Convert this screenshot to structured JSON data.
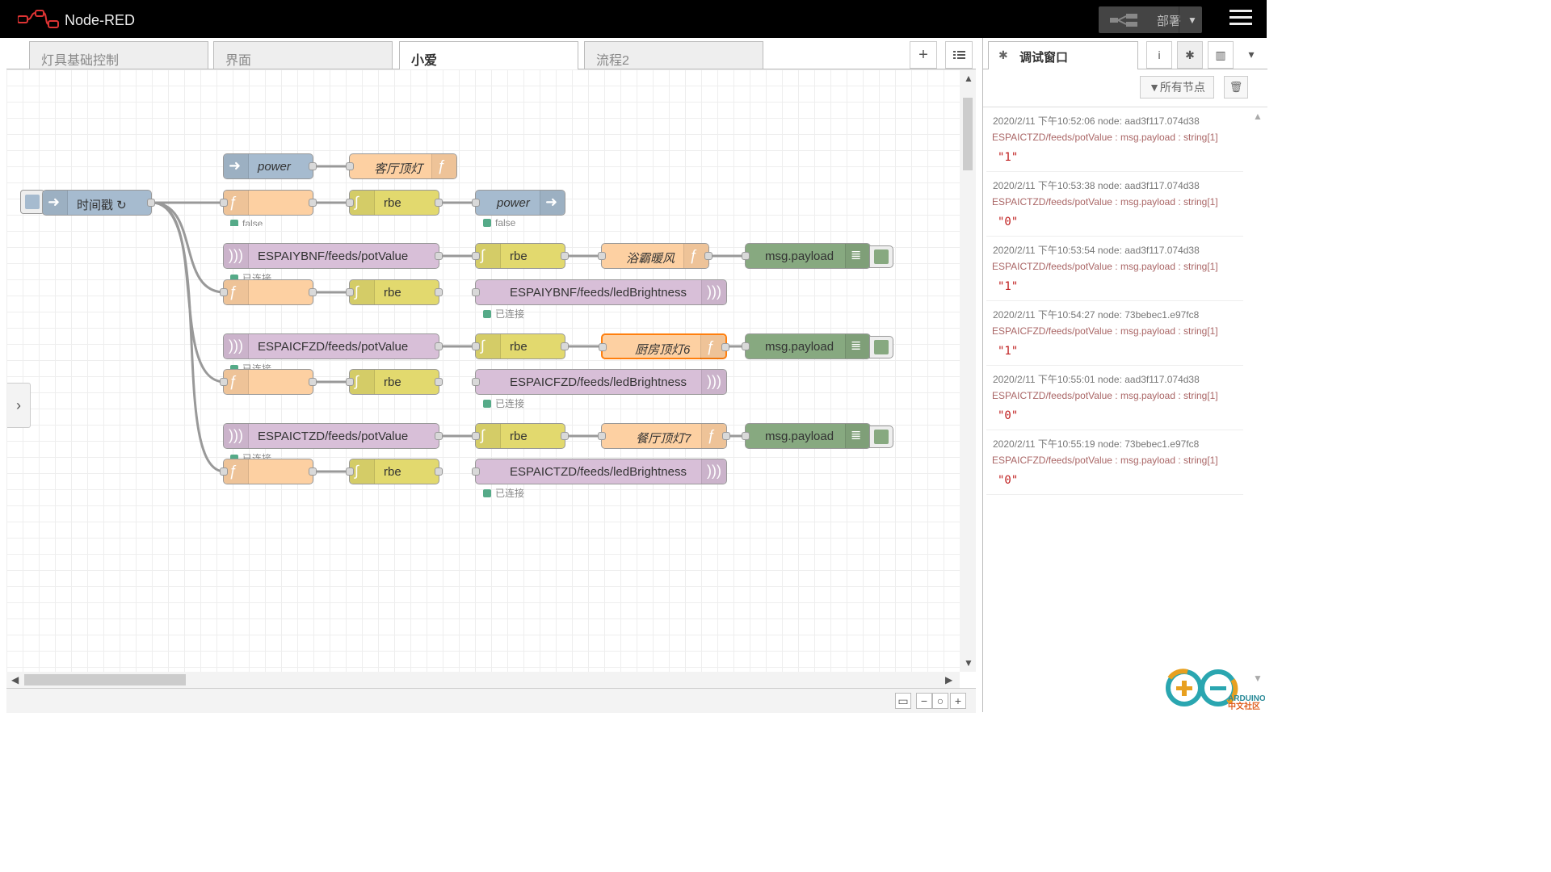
{
  "app": {
    "title": "Node-RED"
  },
  "header": {
    "deploy_label": "部署"
  },
  "tabs": [
    {
      "label": "灯具基础控制",
      "active": false
    },
    {
      "label": "界面",
      "active": false
    },
    {
      "label": "小爱",
      "active": true
    },
    {
      "label": "流程2",
      "active": false
    }
  ],
  "flow": {
    "inject_timestamp": {
      "label": "时间戳 ↻"
    },
    "link_in_power": {
      "label": "power",
      "status": "false"
    },
    "func_living_room": {
      "label": "客厅顶灯"
    },
    "func_1": {
      "label": "",
      "status": "false"
    },
    "rbe_1": {
      "label": "rbe"
    },
    "link_out_power": {
      "label": "power",
      "status": "false"
    },
    "mqtt_in_ybnf": {
      "label": "ESPAIYBNF/feeds/potValue",
      "status": "已连接"
    },
    "rbe_2": {
      "label": "rbe"
    },
    "func_bath_heater": {
      "label": "浴霸暖风"
    },
    "debug_1": {
      "label": "msg.payload"
    },
    "func_2": {
      "label": ""
    },
    "rbe_3": {
      "label": "rbe"
    },
    "mqtt_out_ybnf": {
      "label": "ESPAIYBNF/feeds/ledBrightness",
      "status": "已连接"
    },
    "mqtt_in_cfzd": {
      "label": "ESPAICFZD/feeds/potValue",
      "status": "已连接"
    },
    "rbe_4": {
      "label": "rbe"
    },
    "func_kitchen": {
      "label": "厨房顶灯6"
    },
    "debug_2": {
      "label": "msg.payload"
    },
    "func_3": {
      "label": ""
    },
    "rbe_5": {
      "label": "rbe"
    },
    "mqtt_out_cfzd": {
      "label": "ESPAICFZD/feeds/ledBrightness",
      "status": "已连接"
    },
    "mqtt_in_ctzd": {
      "label": "ESPAICTZD/feeds/potValue",
      "status": "已连接"
    },
    "rbe_6": {
      "label": "rbe"
    },
    "func_dining": {
      "label": "餐厅顶灯7"
    },
    "debug_3": {
      "label": "msg.payload"
    },
    "func_4": {
      "label": ""
    },
    "rbe_7": {
      "label": "rbe"
    },
    "mqtt_out_ctzd": {
      "label": "ESPAICTZD/feeds/ledBrightness",
      "status": "已连接"
    }
  },
  "sidebar": {
    "tab_label": "调试窗口",
    "filter_label": "所有节点",
    "messages": [
      {
        "meta": "2020/2/11 下午10:52:06   node: aad3f117.074d38",
        "topic": "ESPAICTZD/feeds/potValue : msg.payload : string[1]",
        "value": "\"1\""
      },
      {
        "meta": "2020/2/11 下午10:53:38   node: aad3f117.074d38",
        "topic": "ESPAICTZD/feeds/potValue : msg.payload : string[1]",
        "value": "\"0\""
      },
      {
        "meta": "2020/2/11 下午10:53:54   node: aad3f117.074d38",
        "topic": "ESPAICTZD/feeds/potValue : msg.payload : string[1]",
        "value": "\"1\""
      },
      {
        "meta": "2020/2/11 下午10:54:27   node: 73bebec1.e97fc8",
        "topic": "ESPAICFZD/feeds/potValue : msg.payload : string[1]",
        "value": "\"1\""
      },
      {
        "meta": "2020/2/11 下午10:55:01   node: aad3f117.074d38",
        "topic": "ESPAICTZD/feeds/potValue : msg.payload : string[1]",
        "value": "\"0\""
      },
      {
        "meta": "2020/2/11 下午10:55:19   node: 73bebec1.e97fc8",
        "topic": "ESPAICFZD/feeds/potValue : msg.payload : string[1]",
        "value": "\"0\""
      }
    ]
  },
  "watermark": {
    "line1": "ARDUINO",
    "line2": "中文社区"
  },
  "colors": {
    "inject": "#a6bbcf",
    "function": "#fdd0a2",
    "rbe": "#e2d96e",
    "mqtt": "#d8bfd8",
    "debug": "#87a980",
    "selected": "#ff7f0e",
    "debug_topic": "#aa6666",
    "debug_value": "#c02020"
  }
}
